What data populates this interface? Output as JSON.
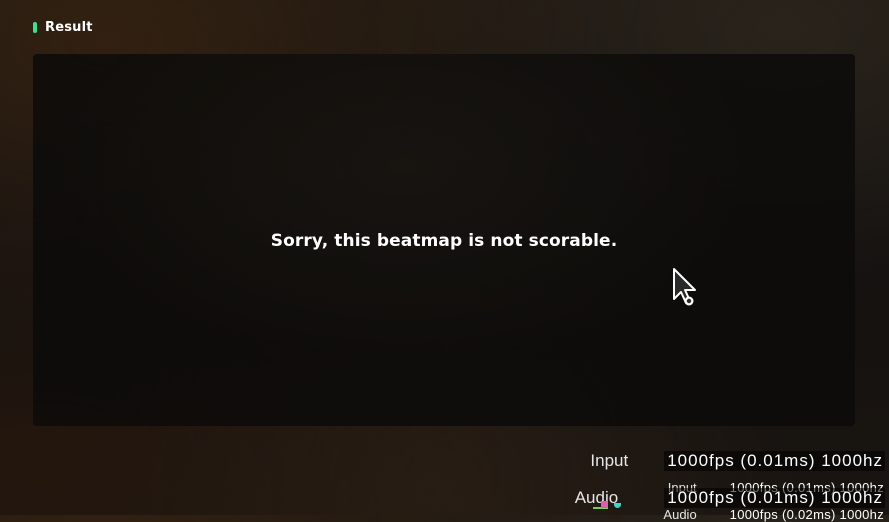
{
  "header": {
    "title": "Result",
    "accent_color": "#3ee08f"
  },
  "result": {
    "message": "Sorry, this beatmap is not scorable."
  },
  "cursor": {
    "icon": "pointer-cursor-icon"
  },
  "performance_overlay": {
    "rows": [
      {
        "label": "Input",
        "value": "1000fps (0.01ms) 1000hz"
      },
      {
        "label": "Audio",
        "value": "1000fps (0.01ms) 1000hz"
      }
    ],
    "overlap_rows": [
      {
        "label": "Input",
        "value": "1000fps (0.01ms) 1000hz"
      },
      {
        "label": "Audio",
        "value": "1000fps (0.02ms) 1000hz"
      }
    ],
    "marker_colors": [
      "#e05ab0",
      "#7fcf4f",
      "#3fd6c8"
    ]
  }
}
